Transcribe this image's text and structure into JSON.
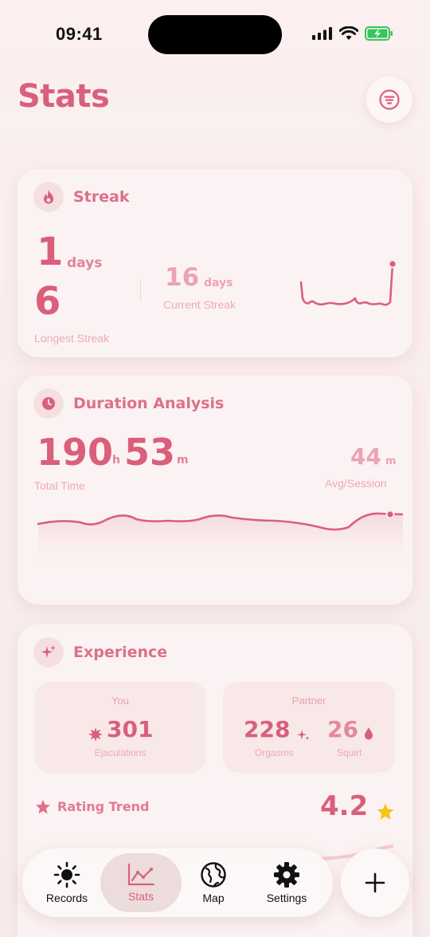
{
  "status_bar": {
    "time": "09:41"
  },
  "header": {
    "title": "Stats"
  },
  "streak": {
    "title": "Streak",
    "longest_value_top": "1",
    "longest_unit": "days",
    "longest_value_bottom": "6",
    "longest_label": "Longest Streak",
    "current_value": "16",
    "current_unit": "days",
    "current_label": "Current Streak"
  },
  "duration": {
    "title": "Duration Analysis",
    "total_hours": "190",
    "hours_unit": "h",
    "total_minutes": "53",
    "minutes_unit": "m",
    "total_label": "Total Time",
    "avg_value": "44",
    "avg_unit": "m",
    "avg_label": "Avg/Session"
  },
  "experience": {
    "title": "Experience",
    "you": {
      "label": "You",
      "ejaculations": "301",
      "ejaculations_label": "Ejaculations"
    },
    "partner": {
      "label": "Partner",
      "orgasms": "228",
      "orgasms_label": "Orgasms",
      "squirt": "26",
      "squirt_label": "Squirt"
    },
    "rating_trend_label": "Rating Trend",
    "rating_value": "4.2"
  },
  "tabs": [
    {
      "label": "Records",
      "icon": "sun-icon"
    },
    {
      "label": "Stats",
      "icon": "chart-icon",
      "active": true
    },
    {
      "label": "Map",
      "icon": "globe-icon"
    },
    {
      "label": "Settings",
      "icon": "gear-icon"
    }
  ],
  "colors": {
    "accent": "#d9607c",
    "accent_light": "#ebaab7",
    "star": "#f5c518"
  }
}
